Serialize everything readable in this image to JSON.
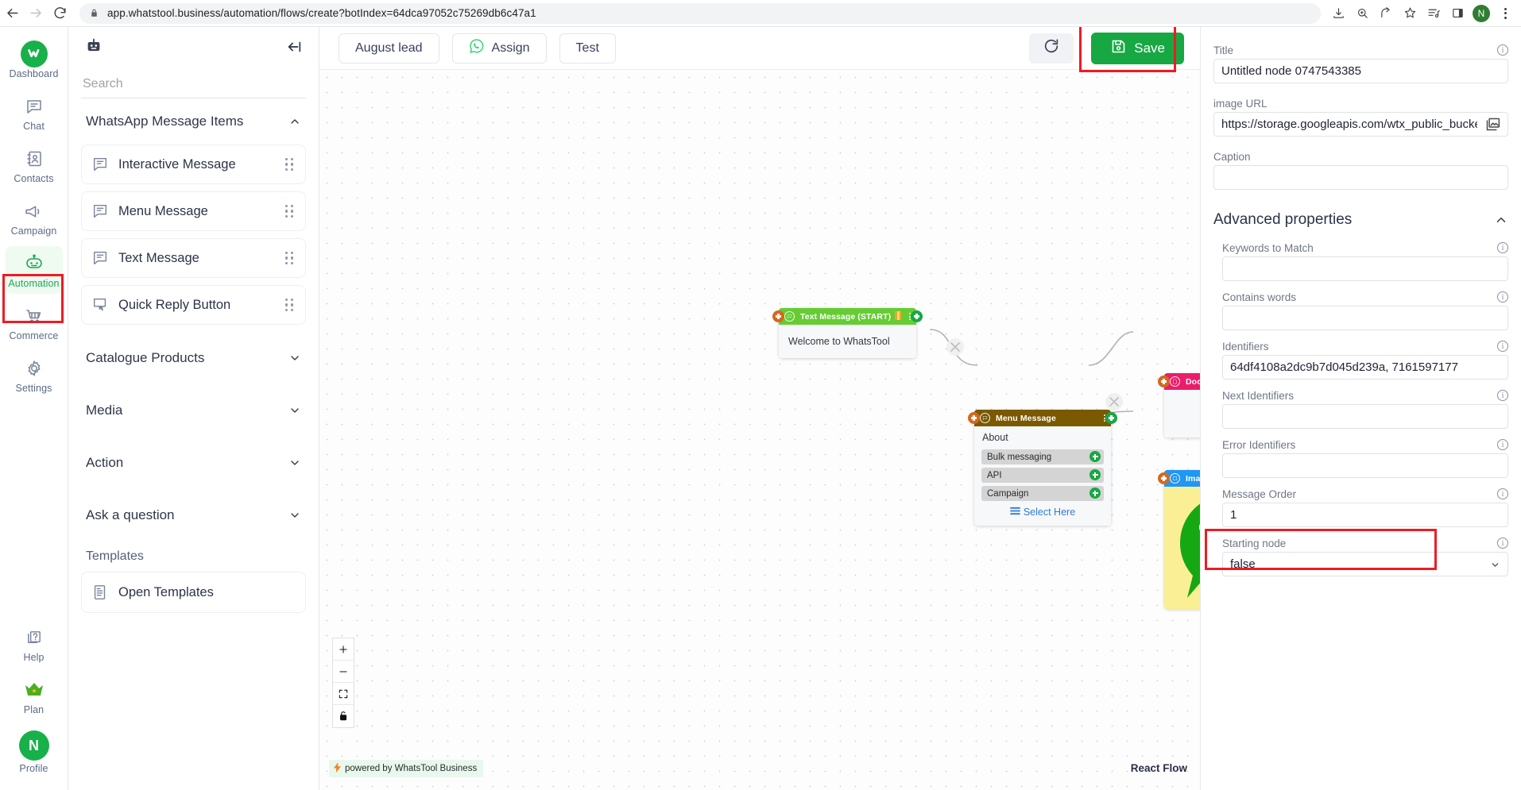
{
  "browser": {
    "url": "app.whatstool.business/automation/flows/create?botIndex=64dca97052c75269db6c47a1",
    "back_icon": "back-arrow-icon",
    "forward_icon": "forward-arrow-icon",
    "reload_icon": "reload-icon",
    "lock_icon": "lock-icon",
    "profile_initial": "N",
    "toolbar_icons": [
      "install-icon",
      "zoom-icon",
      "share-icon",
      "bookmark-star-icon",
      "reading-list-icon",
      "side-panel-icon"
    ]
  },
  "rail": {
    "items": [
      {
        "label": "Dashboard",
        "icon": "whatstool-logo-icon",
        "active": false
      },
      {
        "label": "Chat",
        "icon": "chat-bubble-icon",
        "active": false
      },
      {
        "label": "Contacts",
        "icon": "contacts-icon",
        "active": false
      },
      {
        "label": "Campaign",
        "icon": "megaphone-icon",
        "active": false
      },
      {
        "label": "Automation",
        "icon": "robot-icon",
        "active": true
      },
      {
        "label": "Commerce",
        "icon": "shopping-cart-icon",
        "active": false
      },
      {
        "label": "Settings",
        "icon": "gear-icon",
        "active": false
      }
    ],
    "bottom_items": [
      {
        "label": "Help",
        "icon": "help-icon"
      },
      {
        "label": "Plan",
        "icon": "crown-icon"
      },
      {
        "label": "Profile",
        "icon": "avatar-icon",
        "initial": "N"
      }
    ],
    "highlight_color": "#ed1c24"
  },
  "panel": {
    "bot_icon": "robot-icon",
    "collapse_icon": "collapse-left-icon",
    "search_placeholder": "Search",
    "groups": [
      {
        "title": "WhatsApp Message Items",
        "expanded": true,
        "chevron": "chevron-up-icon",
        "items": [
          {
            "label": "Interactive Message",
            "icon": "message-lines-icon",
            "grip": "drag-handle-icon"
          },
          {
            "label": "Menu Message",
            "icon": "message-lines-icon",
            "grip": "drag-handle-icon"
          },
          {
            "label": "Text Message",
            "icon": "message-lines-icon",
            "grip": "drag-handle-icon"
          },
          {
            "label": "Quick Reply Button",
            "icon": "quick-reply-icon",
            "grip": "drag-handle-icon"
          }
        ]
      },
      {
        "title": "Catalogue Products",
        "expanded": false,
        "chevron": "chevron-down-icon",
        "items": []
      },
      {
        "title": "Media",
        "expanded": false,
        "chevron": "chevron-down-icon",
        "items": []
      },
      {
        "title": "Action",
        "expanded": false,
        "chevron": "chevron-down-icon",
        "items": []
      },
      {
        "title": "Ask a question",
        "expanded": false,
        "chevron": "chevron-down-icon",
        "items": []
      }
    ],
    "templates_title": "Templates",
    "open_templates_label": "Open Templates",
    "open_templates_icon": "template-document-icon"
  },
  "toolbar": {
    "flow_name": "August lead",
    "assign_label": "Assign",
    "assign_icon": "whatsapp-icon",
    "test_label": "Test",
    "refresh_icon": "refresh-icon",
    "save_label": "Save",
    "save_icon": "floppy-disk-icon",
    "save_color": "#17a843",
    "save_highlight_color": "#ed1c24"
  },
  "canvas": {
    "nodes": [
      {
        "id": "text-message",
        "title": "Text Message (START)",
        "header_color": "#66cc33",
        "badge": "flag-icon",
        "body_text": "Welcome to WhatsTool",
        "icon": "message-node-icon"
      },
      {
        "id": "menu-message",
        "title": "Menu Message",
        "header_color": "#7a5900",
        "body_text": "About",
        "icon": "message-node-icon",
        "options": [
          "Bulk messaging",
          "API",
          "Campaign"
        ],
        "select_label": "Select Here",
        "select_icon": "list-icon"
      },
      {
        "id": "document",
        "title": "Document",
        "header_color": "#eb1c6b",
        "icon": "document-node-icon",
        "body_icon": "pdf-icon"
      },
      {
        "id": "image",
        "title": "Image",
        "header_color": "#2196f3",
        "icon": "image-node-icon",
        "body_icon": "whatstool-logo-image"
      }
    ],
    "controls": [
      {
        "name": "zoom-in",
        "icon": "plus-icon"
      },
      {
        "name": "zoom-out",
        "icon": "minus-icon"
      },
      {
        "name": "fit-view",
        "icon": "fit-screen-icon"
      },
      {
        "name": "lock",
        "icon": "lock-open-icon"
      }
    ],
    "powered_by": "powered by WhatsTool Business",
    "powered_icon": "bolt-icon",
    "attribution": "React Flow"
  },
  "props": {
    "title_label": "Title",
    "title_value": "Untitled node 0747543385",
    "image_url_label": "image URL",
    "image_url_value": "https://storage.googleapis.com/wtx_public_bucket_pro",
    "image_picker_icon": "image-picker-icon",
    "caption_label": "Caption",
    "caption_value": "",
    "advanced_title": "Advanced properties",
    "advanced_chevron": "chevron-up-icon",
    "fields": [
      {
        "label": "Keywords to Match",
        "value": "",
        "type": "text"
      },
      {
        "label": "Contains words",
        "value": "",
        "type": "text"
      },
      {
        "label": "Identifiers",
        "value": "64df4108a2dc9b7d045d239a, 7161597177",
        "type": "text"
      },
      {
        "label": "Next Identifiers",
        "value": "",
        "type": "text"
      },
      {
        "label": "Error Identifiers",
        "value": "",
        "type": "text"
      },
      {
        "label": "Message Order",
        "value": "1",
        "type": "text",
        "highlighted": true
      },
      {
        "label": "Starting node",
        "value": "false",
        "type": "select"
      }
    ],
    "highlight_color": "#ed1c24",
    "info_icon": "info-icon"
  }
}
